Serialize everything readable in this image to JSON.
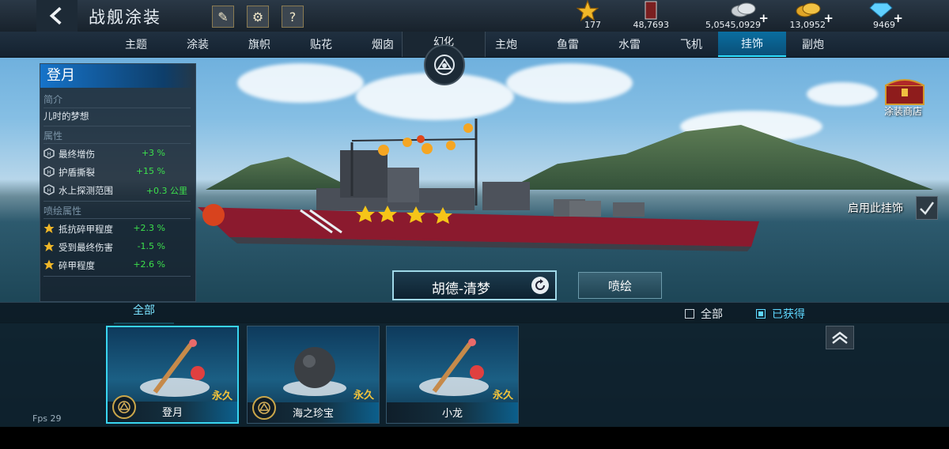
{
  "header": {
    "title": "战舰涂装",
    "help_label": "?"
  },
  "resources": [
    {
      "icon": "star-icon",
      "value": "177"
    },
    {
      "icon": "fuel-barrel-icon",
      "value": "48,7693"
    },
    {
      "icon": "silver-coins-icon",
      "value": "5,0545,0929"
    },
    {
      "icon": "gold-coins-icon",
      "value": "13,0952"
    },
    {
      "icon": "diamond-icon",
      "value": "9469"
    }
  ],
  "tabs": {
    "left": [
      "主题",
      "涂装",
      "旗帜",
      "贴花",
      "烟囱"
    ],
    "center": "幻化",
    "right": [
      "主炮",
      "鱼雷",
      "水雷",
      "飞机",
      "挂饰",
      "副炮"
    ],
    "active": "挂饰"
  },
  "info_panel": {
    "name": "登月",
    "intro_heading": "简介",
    "intro_text": "儿时的梦想",
    "attributes_heading": "属性",
    "attributes": [
      {
        "name": "最终增伤",
        "value": "+3 %"
      },
      {
        "name": "护盾撕裂",
        "value": "+15 %"
      },
      {
        "name": "水上探测范围",
        "value": "+0.3 公里"
      }
    ],
    "paint_heading": "喷绘属性",
    "paint_attributes": [
      {
        "name": "抵抗碎甲程度",
        "value": "+2.3 %"
      },
      {
        "name": "受到最终伤害",
        "value": "-1.5 %"
      },
      {
        "name": "碎甲程度",
        "value": "+2.6 %"
      }
    ]
  },
  "shop_label": "涂装商店",
  "enable_label": "启用此挂饰",
  "skin_name": "胡德-清梦",
  "paint_button": "喷绘",
  "bottom": {
    "all_tab": "全部",
    "filter_all": "全部",
    "filter_owned": "已获得",
    "items": [
      {
        "name": "登月",
        "duration": "永久",
        "selected": true
      },
      {
        "name": "海之珍宝",
        "duration": "永久",
        "selected": false
      },
      {
        "name": "小龙",
        "duration": "永久",
        "selected": false
      }
    ]
  },
  "fps": "Fps 29",
  "colors": {
    "accent": "#2ee0ff",
    "positive": "#3ce04c",
    "permanent": "#f3c43a",
    "active_tab": "#0a6ea0"
  }
}
